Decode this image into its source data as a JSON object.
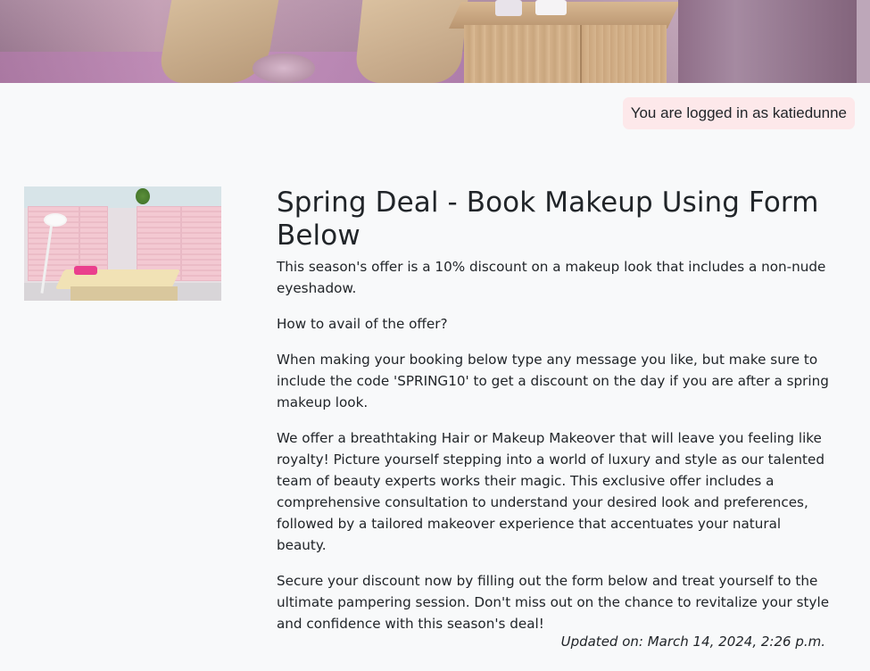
{
  "header": {
    "banner_image": "salon-interior-banner"
  },
  "user": {
    "login_status": "You are logged in as katiedunne"
  },
  "post": {
    "thumbnail": "salon-treatment-room-image",
    "title": "Spring Deal - Book Makeup Using Form Below",
    "paragraphs": [
      "This season's offer is a 10% discount on a makeup look that includes a non-nude eyeshadow.",
      "How to avail of the offer?",
      "When making your booking below type any message you like, but make sure to include the code 'SPRING10' to get a discount on the day if you are after a spring makeup look.",
      "We offer a breathtaking Hair or Makeup Makeover that will leave you feeling like royalty! Picture yourself stepping into a world of luxury and style as our talented team of beauty experts works their magic. This exclusive offer includes a comprehensive consultation to understand your desired look and preferences, followed by a tailored makeover experience that accentuates your natural beauty.",
      "Secure your discount now by filling out the form below and treat yourself to the ultimate pampering session. Don't miss out on the chance to revitalize your style and confidence with this season's deal!"
    ],
    "updated": "Updated on: March 14, 2024, 2:26 p.m."
  },
  "colors": {
    "background": "#f8f9fa",
    "badge_background": "#fde8ea",
    "text": "#212529"
  }
}
